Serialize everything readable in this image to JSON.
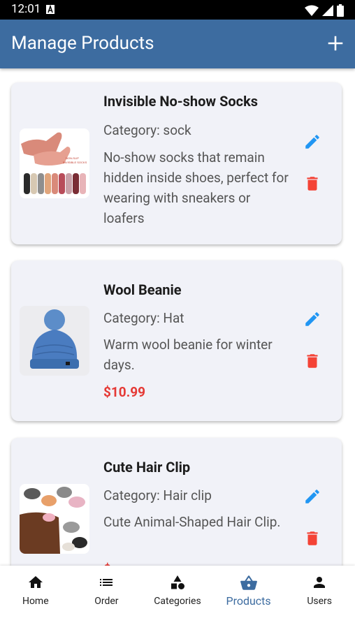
{
  "status_bar": {
    "time": "12:01"
  },
  "app_bar": {
    "title": "Manage Products"
  },
  "products": [
    {
      "name": "Invisible No-show Socks",
      "category": "Category: sock",
      "description": "No-show socks that remain hidden inside shoes, perfect for wearing with sneakers or loafers",
      "price": ""
    },
    {
      "name": "Wool Beanie",
      "category": "Category: Hat",
      "description": "Warm wool beanie for winter days.",
      "price": "$10.99"
    },
    {
      "name": "Cute Hair Clip",
      "category": "Category: Hair clip",
      "description": "Cute Animal-Shaped Hair Clip.",
      "price": "$"
    }
  ],
  "bottom_nav": [
    {
      "label": "Home",
      "icon": "home-icon"
    },
    {
      "label": "Order",
      "icon": "list-icon"
    },
    {
      "label": "Categories",
      "icon": "categories-icon"
    },
    {
      "label": "Products",
      "icon": "basket-icon",
      "active": true
    },
    {
      "label": "Users",
      "icon": "person-icon"
    }
  ],
  "colors": {
    "app_bar": "#3d6ca0",
    "edit_icon": "#2196f3",
    "delete_icon": "#f44336",
    "price": "#e53935"
  }
}
